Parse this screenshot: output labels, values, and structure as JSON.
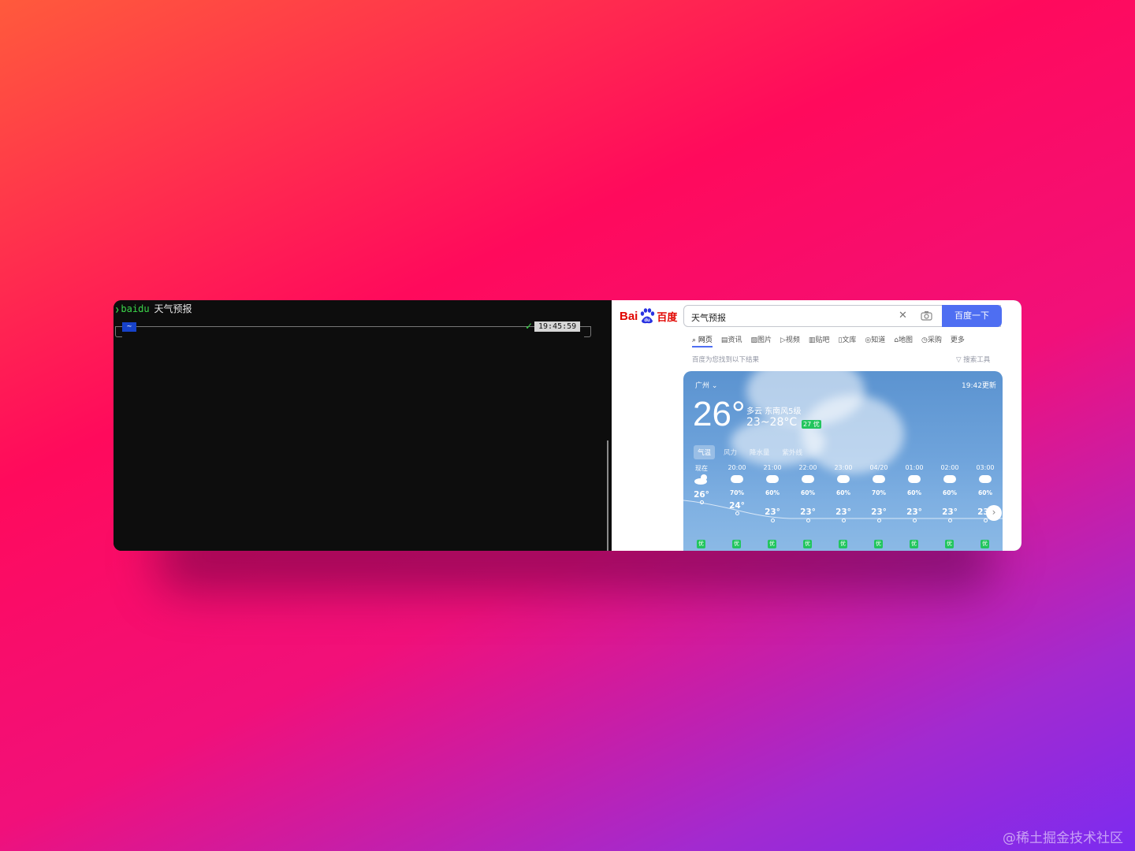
{
  "terminal": {
    "command": "baidu",
    "argument": "天气预报",
    "directory": "~",
    "time": "19:45:59"
  },
  "browser": {
    "logo_latin": "Bai",
    "logo_cn": "百度",
    "search_value": "天气预报",
    "search_button": "百度一下",
    "tabs": [
      "网页",
      "资讯",
      "图片",
      "视频",
      "贴吧",
      "文库",
      "知道",
      "地图",
      "采购",
      "更多"
    ],
    "result_hint": "百度为您找到以下结果",
    "search_tools": "搜索工具"
  },
  "weather": {
    "city": "广州",
    "updated": "19:42更新",
    "current_temp": "26°",
    "condition": "多云 东南风5级",
    "range": "23~28°C",
    "aqi": "27 优",
    "tabs": [
      "气温",
      "风力",
      "降水量",
      "紫外线"
    ],
    "hours": [
      {
        "time": "现在",
        "precip": "",
        "temp": "26°",
        "air": "优"
      },
      {
        "time": "20:00",
        "precip": "70%",
        "temp": "24°",
        "air": "优"
      },
      {
        "time": "21:00",
        "precip": "60%",
        "temp": "23°",
        "air": "优"
      },
      {
        "time": "22:00",
        "precip": "60%",
        "temp": "23°",
        "air": "优"
      },
      {
        "time": "23:00",
        "precip": "60%",
        "temp": "23°",
        "air": "优"
      },
      {
        "time": "04/20",
        "precip": "70%",
        "temp": "23°",
        "air": "优"
      },
      {
        "time": "01:00",
        "precip": "60%",
        "temp": "23°",
        "air": "优"
      },
      {
        "time": "02:00",
        "precip": "60%",
        "temp": "23°",
        "air": "优"
      },
      {
        "time": "03:00",
        "precip": "60%",
        "temp": "23°",
        "air": "优"
      }
    ]
  },
  "watermark": "@稀土掘金技术社区"
}
